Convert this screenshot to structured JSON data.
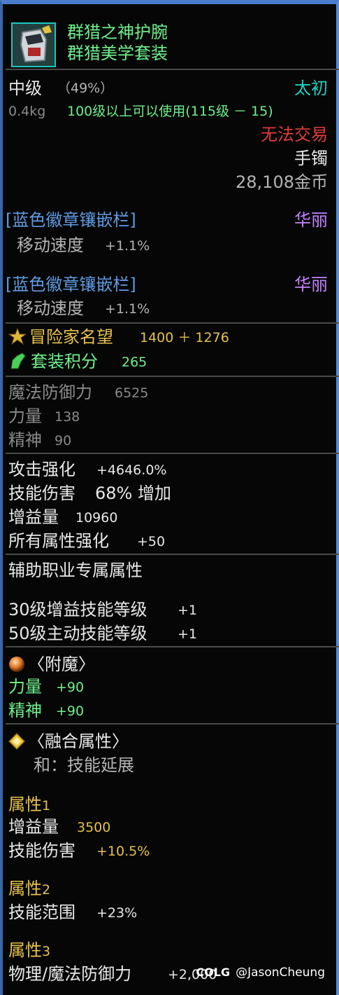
{
  "item": {
    "name": "群猎之神护腕",
    "set_name": "群猎美学套装",
    "grade": "中级",
    "grade_percent": "（49%）",
    "rarity": "太初",
    "weight": "0.4kg",
    "level_req": "100级以上可以使用(115级 － 15)",
    "trade_status": "无法交易",
    "slot": "手镯",
    "price": "28,108金币"
  },
  "sockets": [
    {
      "name": "[蓝色徽章镶嵌栏]",
      "quality": "华丽",
      "stat_name": "移动速度",
      "stat_value": "+1.1%"
    },
    {
      "name": "[蓝色徽章镶嵌栏]",
      "quality": "华丽",
      "stat_name": "移动速度",
      "stat_value": "+1.1%"
    }
  ],
  "fame": {
    "label": "冒险家名望",
    "value": "1400 ＋ 1276",
    "icon": "fame-star-icon"
  },
  "set_points": {
    "label": "套装积分",
    "value": "265",
    "icon": "set-points-icon"
  },
  "base_stats": [
    {
      "name": "魔法防御力",
      "value": "6525"
    },
    {
      "name": "力量",
      "value": "138"
    },
    {
      "name": "精神",
      "value": "90"
    }
  ],
  "main_stats": [
    {
      "name": "攻击强化",
      "value": "+4646.0%"
    },
    {
      "name": "技能伤害",
      "value": "68% 增加"
    },
    {
      "name": "增益量",
      "value": "10960"
    },
    {
      "name": "所有属性强化",
      "value": "+50"
    }
  ],
  "support_section": {
    "title": "辅助职业专属属性",
    "lines": [
      {
        "name": "30级增益技能等级",
        "value": "+1"
      },
      {
        "name": "50级主动技能等级",
        "value": "+1"
      }
    ]
  },
  "enchant": {
    "title": "〈附魔〉",
    "icon": "enchant-orb-icon",
    "stats": [
      {
        "name": "力量",
        "value": "+90"
      },
      {
        "name": "精神",
        "value": "+90"
      }
    ]
  },
  "fusion": {
    "title": "〈融合属性〉",
    "icon": "fusion-diamond-icon",
    "subtitle": "和：技能延展",
    "attr1": {
      "label": "属性",
      "num": "1",
      "lines": [
        {
          "name": "增益量",
          "value": "3500"
        },
        {
          "name": "技能伤害",
          "value": "+10.5%"
        }
      ]
    },
    "attr2": {
      "label": "属性",
      "num": "2",
      "lines": [
        {
          "name": "技能范围",
          "value": "+23%"
        }
      ]
    },
    "attr3": {
      "label": "属性",
      "num": "3",
      "lines": [
        {
          "name": "物理/魔法防御力",
          "value": "+2,000"
        }
      ]
    }
  },
  "watermark": {
    "logo": "COLG",
    "name": "@JasonCheung"
  },
  "colors": {
    "rarity": "#1ed2c6",
    "trade": "#e23b3b",
    "socket": "#5f9be3",
    "quality": "#c482ff",
    "value_gold": "#e7c24a",
    "green": "#6ff08b"
  }
}
